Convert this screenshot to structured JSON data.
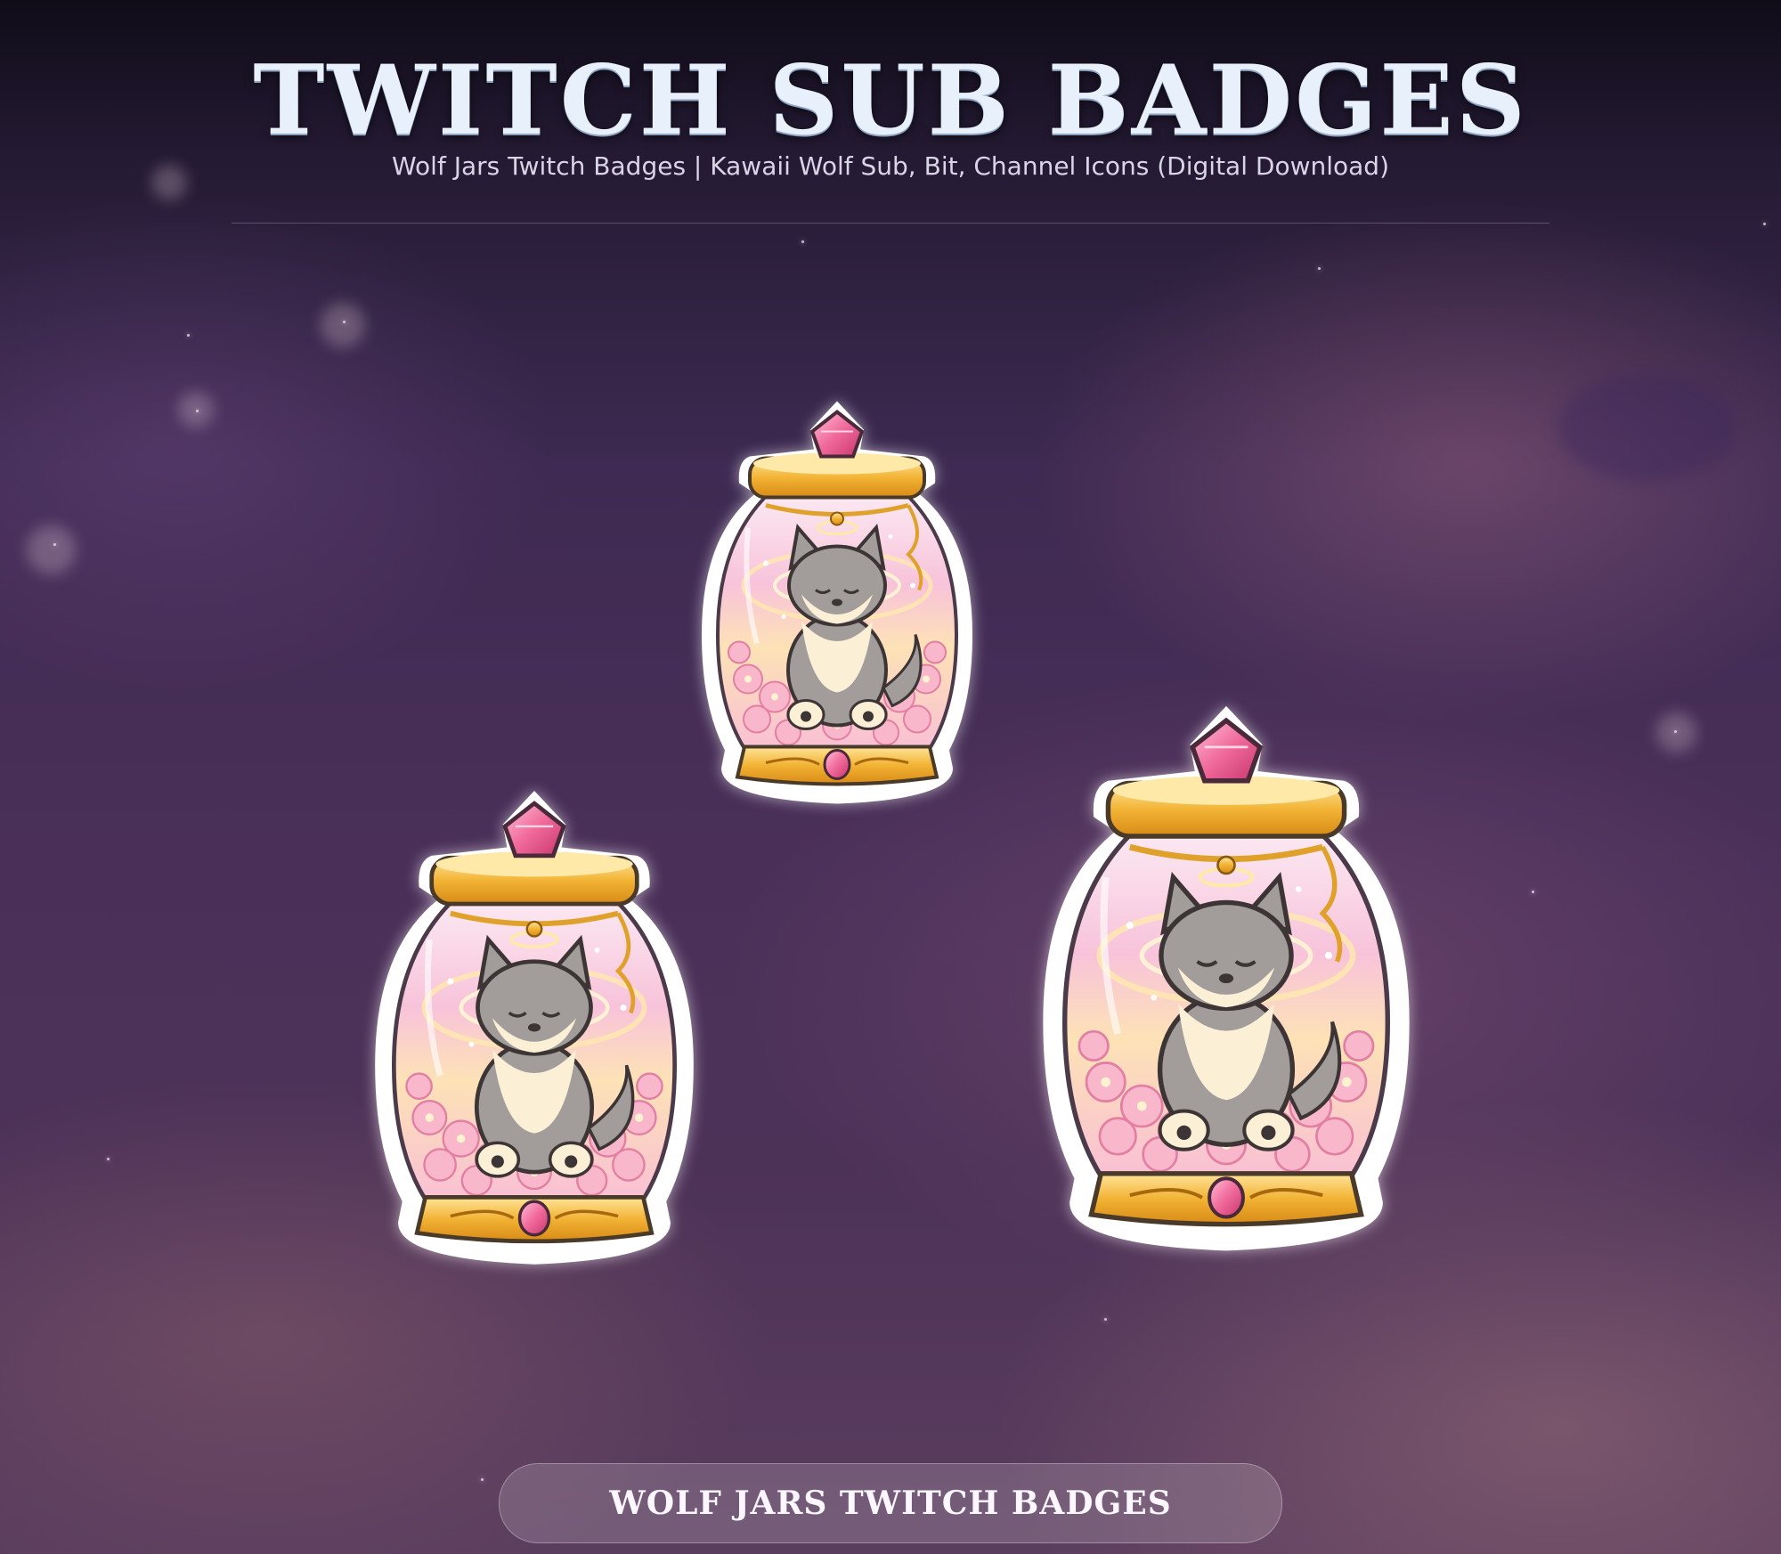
{
  "header": {
    "title": "TWITCH SUB BADGES",
    "subtitle": "Wolf Jars Twitch Badges | Kawaii Wolf Sub, Bit, Channel Icons (Digital Download)"
  },
  "badges": [
    {
      "icon": "wolf-jar-icon"
    },
    {
      "icon": "wolf-jar-icon"
    },
    {
      "icon": "wolf-jar-icon"
    }
  ],
  "footer": {
    "label": "WOLF JARS TWITCH BADGES"
  },
  "colors": {
    "title": "#e7f0fb",
    "gold": "#f2b334",
    "gem": "#f06a9a",
    "jar_pink": "#f9c6d8",
    "wolf_gray": "#9a9592"
  }
}
